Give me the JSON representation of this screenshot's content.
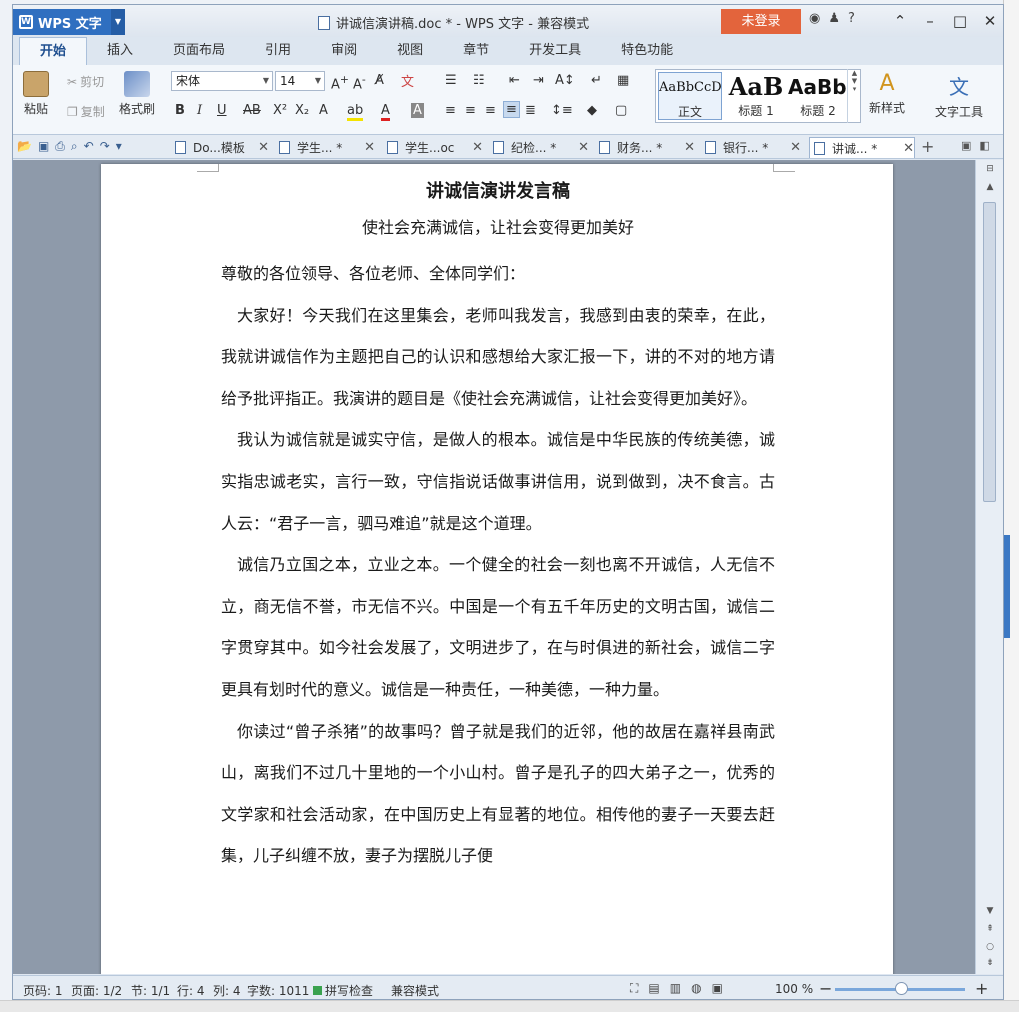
{
  "titlebar": {
    "app_name": "WPS 文字",
    "title": "讲诚信演讲稿.doc * - WPS 文字 - 兼容模式",
    "login_label": "未登录"
  },
  "ribbon_tabs": [
    {
      "label": "开始",
      "active": true
    },
    {
      "label": "插入"
    },
    {
      "label": "页面布局"
    },
    {
      "label": "引用"
    },
    {
      "label": "审阅"
    },
    {
      "label": "视图"
    },
    {
      "label": "章节"
    },
    {
      "label": "开发工具"
    },
    {
      "label": "特色功能"
    }
  ],
  "toolbar": {
    "paste": "粘贴",
    "cut": "剪切",
    "copy": "复制",
    "format_painter": "格式刷",
    "font_name": "宋体",
    "font_size": "14",
    "styles": [
      {
        "preview": "AaBbCcD",
        "label": "正文"
      },
      {
        "preview": "AaB",
        "label": "标题 1"
      },
      {
        "preview": "AaBb(",
        "label": "标题 2"
      }
    ],
    "new_style": "新样式",
    "text_tools": "文字工具"
  },
  "doc_tabs": [
    {
      "label": "Do...模板"
    },
    {
      "label": "学生... *"
    },
    {
      "label": "学生...oc"
    },
    {
      "label": "纪检... *"
    },
    {
      "label": "财务... *"
    },
    {
      "label": "银行... *"
    },
    {
      "label": "讲诚... *",
      "active": true
    }
  ],
  "document": {
    "title": "讲诚信演讲发言稿",
    "subtitle": "使社会充满诚信，让社会变得更加美好",
    "salutation": "尊敬的各位领导、各位老师、全体同学们：",
    "paragraphs": [
      "大家好！今天我们在这里集会，老师叫我发言，我感到由衷的荣幸，在此，我就讲诚信作为主题把自己的认识和感想给大家汇报一下，讲的不对的地方请给予批评指正。我演讲的题目是《使社会充满诚信，让社会变得更加美好》。",
      "我认为诚信就是诚实守信，是做人的根本。诚信是中华民族的传统美德，诚实指忠诚老实，言行一致，守信指说话做事讲信用，说到做到，决不食言。古人云：“君子一言，驷马难追”就是这个道理。",
      "诚信乃立国之本，立业之本。一个健全的社会一刻也离不开诚信，人无信不立，商无信不誉，市无信不兴。中国是一个有五千年历史的文明古国，诚信二字贯穿其中。如今社会发展了，文明进步了，在与时俱进的新社会，诚信二字更具有划时代的意义。诚信是一种责任，一种美德，一种力量。",
      "你读过“曾子杀猪”的故事吗？曾子就是我们的近邻，他的故居在嘉祥县南武山，离我们不过几十里地的一个小山村。曾子是孔子的四大弟子之一，优秀的文学家和社会活动家，在中国历史上有显著的地位。相传他的妻子一天要去赶集，儿子纠缠不放，妻子为摆脱儿子便"
    ]
  },
  "statusbar": {
    "page_num": "页码: 1",
    "pages": "页面: 1/2",
    "section": "节: 1/1",
    "row": "行: 4",
    "col": "列: 4",
    "word_count": "字数: 1011",
    "spell_check": "拼写检查",
    "compat_mode": "兼容模式",
    "zoom": "100 %",
    "zoom_level_percent": 100
  }
}
